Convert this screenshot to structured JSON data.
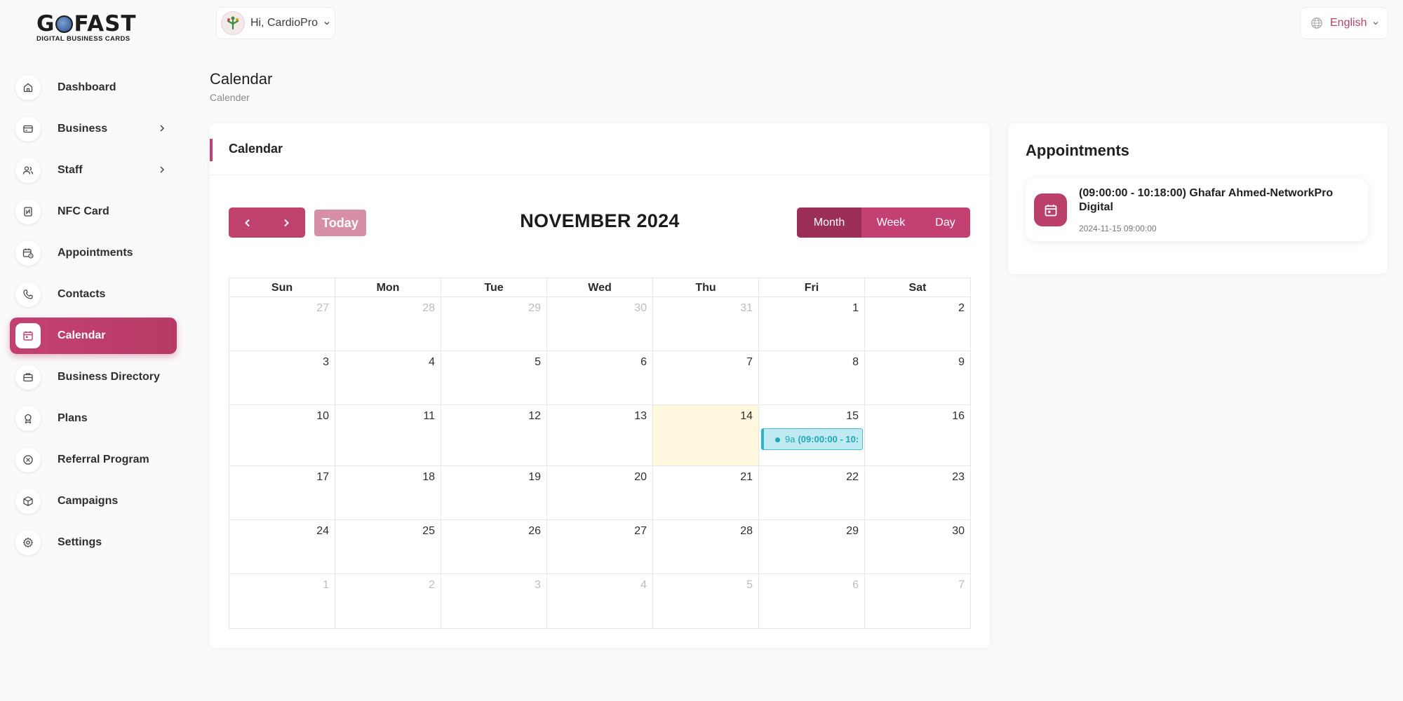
{
  "logo": {
    "main_left": "G",
    "main_right": "FAST",
    "sub": "DIGITAL BUSINESS CARDS"
  },
  "header": {
    "greeting": "Hi, CardioPro",
    "language": "English"
  },
  "sidebar": {
    "items": [
      {
        "label": "Dashboard",
        "icon": "home-icon"
      },
      {
        "label": "Business",
        "icon": "card-icon",
        "expandable": true
      },
      {
        "label": "Staff",
        "icon": "users-icon",
        "expandable": true
      },
      {
        "label": "NFC Card",
        "icon": "nfc-icon"
      },
      {
        "label": "Appointments",
        "icon": "calendar-clock-icon"
      },
      {
        "label": "Contacts",
        "icon": "phone-icon"
      },
      {
        "label": "Calendar",
        "icon": "calendar-icon",
        "active": true
      },
      {
        "label": "Business Directory",
        "icon": "briefcase-icon"
      },
      {
        "label": "Plans",
        "icon": "award-icon"
      },
      {
        "label": "Referral Program",
        "icon": "referral-icon"
      },
      {
        "label": "Campaigns",
        "icon": "box-icon"
      },
      {
        "label": "Settings",
        "icon": "gear-icon"
      }
    ]
  },
  "page": {
    "title": "Calendar",
    "breadcrumb": "Calender"
  },
  "calendar": {
    "card_title": "Calendar",
    "today_label": "Today",
    "month_title": "NOVEMBER 2024",
    "views": [
      "Month",
      "Week",
      "Day"
    ],
    "selected_view": "Month",
    "weekdays": [
      "Sun",
      "Mon",
      "Tue",
      "Wed",
      "Thu",
      "Fri",
      "Sat"
    ],
    "weeks": [
      [
        {
          "d": "27",
          "m": true
        },
        {
          "d": "28",
          "m": true
        },
        {
          "d": "29",
          "m": true
        },
        {
          "d": "30",
          "m": true
        },
        {
          "d": "31",
          "m": true
        },
        {
          "d": "1"
        },
        {
          "d": "2"
        }
      ],
      [
        {
          "d": "3"
        },
        {
          "d": "4"
        },
        {
          "d": "5"
        },
        {
          "d": "6"
        },
        {
          "d": "7"
        },
        {
          "d": "8"
        },
        {
          "d": "9"
        }
      ],
      [
        {
          "d": "10"
        },
        {
          "d": "11"
        },
        {
          "d": "12"
        },
        {
          "d": "13"
        },
        {
          "d": "14",
          "today": true
        },
        {
          "d": "15",
          "event": true
        },
        {
          "d": "16"
        }
      ],
      [
        {
          "d": "17"
        },
        {
          "d": "18"
        },
        {
          "d": "19"
        },
        {
          "d": "20"
        },
        {
          "d": "21"
        },
        {
          "d": "22"
        },
        {
          "d": "23"
        }
      ],
      [
        {
          "d": "24"
        },
        {
          "d": "25"
        },
        {
          "d": "26"
        },
        {
          "d": "27"
        },
        {
          "d": "28"
        },
        {
          "d": "29"
        },
        {
          "d": "30"
        }
      ],
      [
        {
          "d": "1",
          "m": true
        },
        {
          "d": "2",
          "m": true
        },
        {
          "d": "3",
          "m": true
        },
        {
          "d": "4",
          "m": true
        },
        {
          "d": "5",
          "m": true
        },
        {
          "d": "6",
          "m": true
        },
        {
          "d": "7",
          "m": true
        }
      ]
    ],
    "event": {
      "time": "9a",
      "title": "(09:00:00 - 10:"
    }
  },
  "appointments": {
    "title": "Appointments",
    "items": [
      {
        "text": "(09:00:00 - 10:18:00) Ghafar Ahmed-NetworkPro Digital",
        "date": "2024-11-15 09:00:00"
      }
    ]
  },
  "colors": {
    "accent": "#c34172",
    "accent_dark": "#9c2f57",
    "today_bg": "#fff8df",
    "event_bg": "#bfeaf1",
    "event_fg": "#20a6b8"
  }
}
